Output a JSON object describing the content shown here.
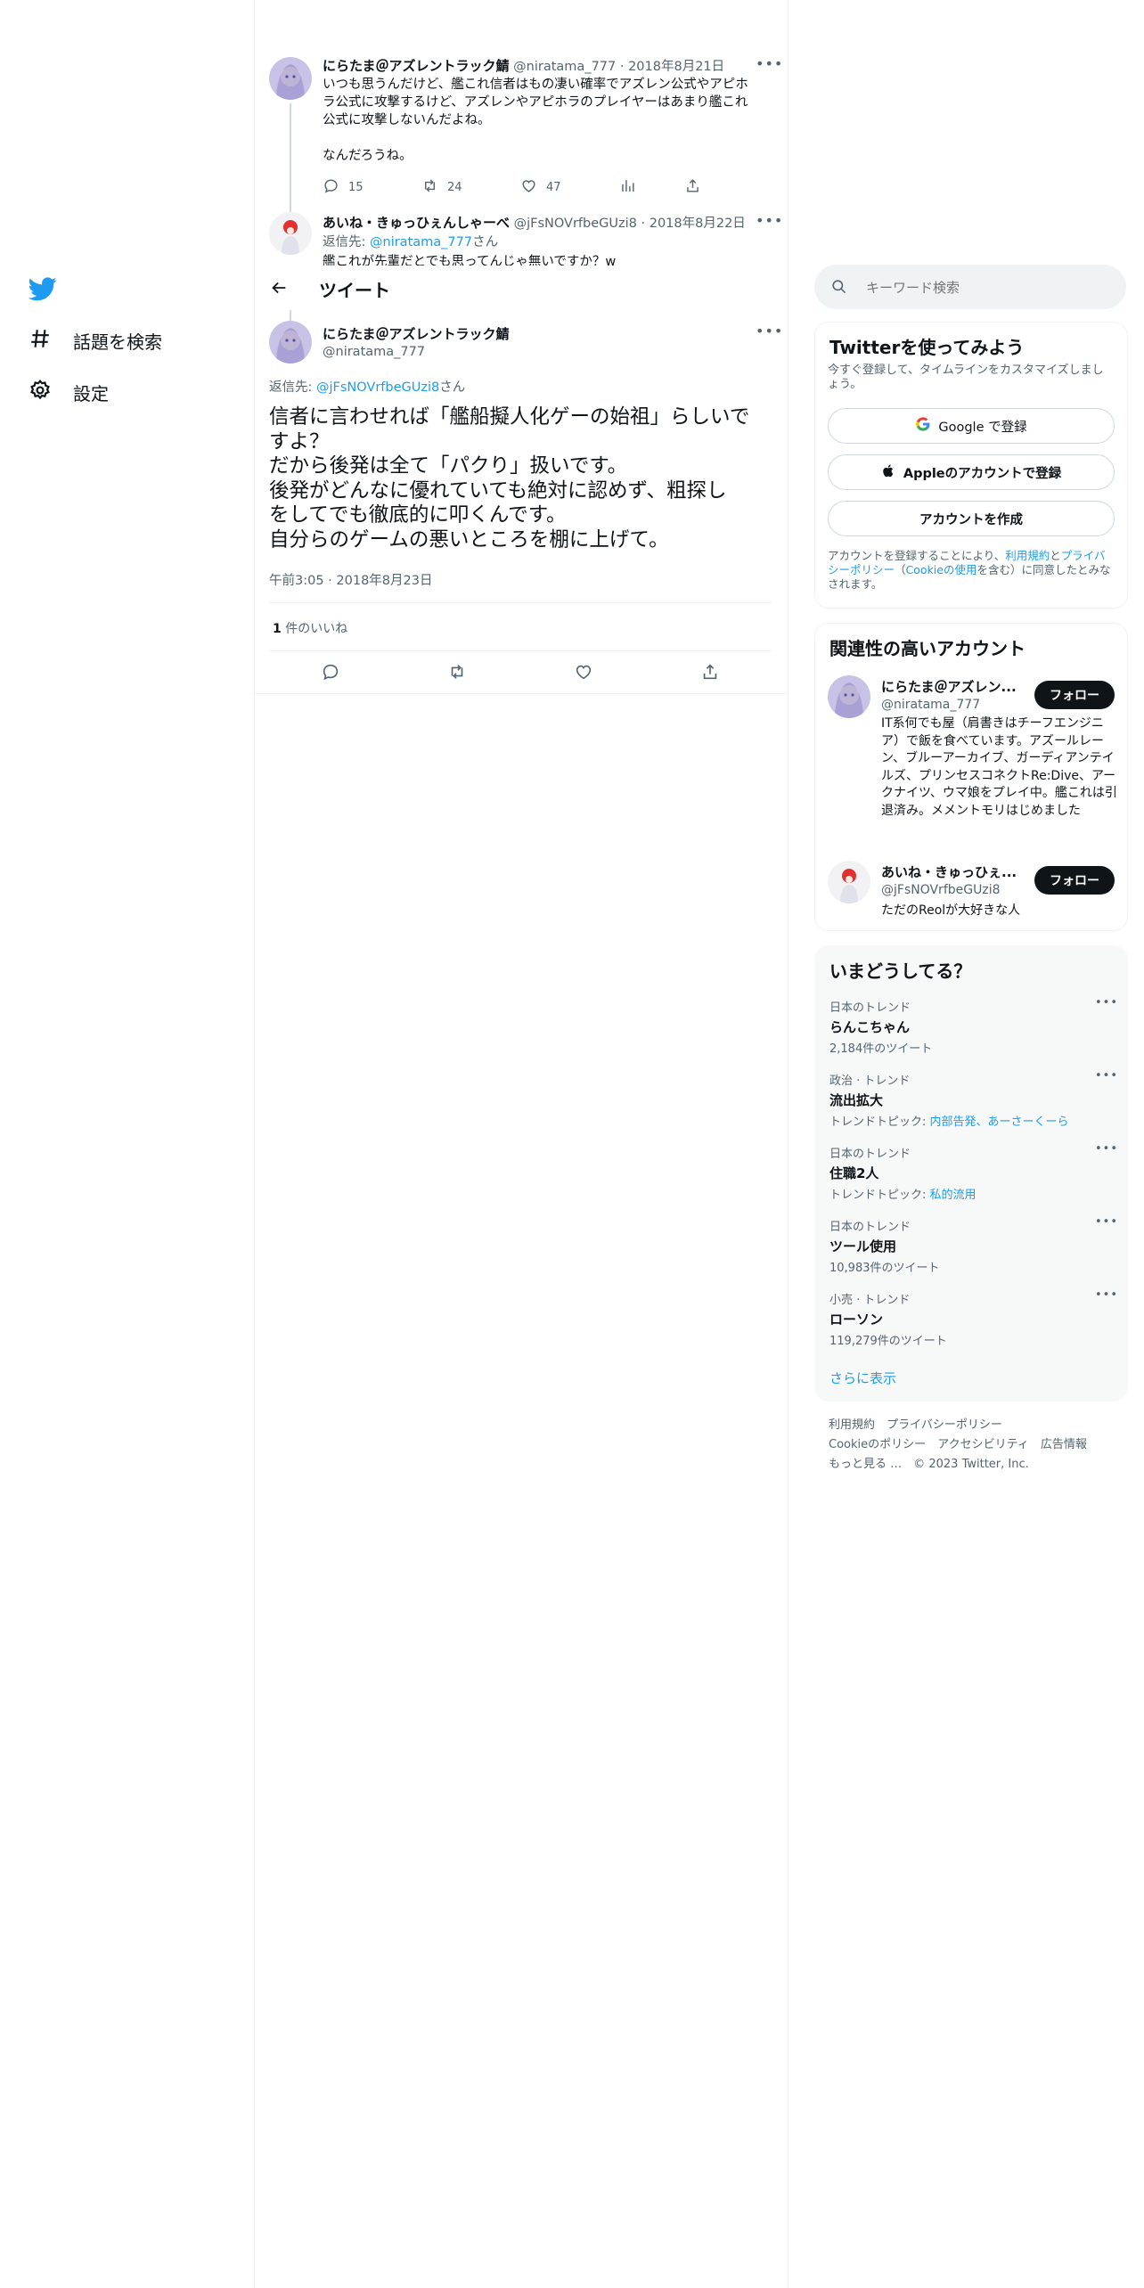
{
  "nav": {
    "items": [
      {
        "label": "話題を検索",
        "icon": "hashtag-icon"
      },
      {
        "label": "設定",
        "icon": "gear-icon"
      }
    ]
  },
  "header": {
    "title": "ツイート"
  },
  "context_tweets": [
    {
      "display_name": "にらたま＠アズレントラック鯖",
      "handle": "@niratama_777",
      "date": "2018年8月21日",
      "text_line1": "いつも思うんだけど、艦これ信者はもの凄い確率でアズレン公式やアピホ",
      "text_line2": "ラ公式に攻撃するけど、アズレンやアピホラのプレイヤーはあまり艦これ",
      "text_line3": "公式に攻撃しないんだよね。",
      "text_line4": "なんだろうね。",
      "replies": "15",
      "retweets": "24",
      "likes": "47"
    },
    {
      "display_name": "あいね・きゅっひぇんしゃーべ",
      "handle": "@jFsNOVrfbeGUzi8",
      "date": "2018年8月22日",
      "reply_prefix": "返信先: ",
      "reply_to": "@niratama_777",
      "reply_suffix": "さん",
      "text_partial": "艦これが先輩だとでも思ってんじゃ無いですか？w"
    }
  ],
  "main_tweet": {
    "display_name": "にらたま＠アズレントラック鯖",
    "handle": "@niratama_777",
    "reply_prefix": "返信先: ",
    "reply_to": "@jFsNOVrfbeGUzi8",
    "reply_suffix": "さん",
    "lines": [
      "信者に言わせれば「艦船擬人化ゲーの始祖」らしいで",
      "すよ？",
      "だから後発は全て「パクり」扱いです。",
      "後発がどんなに優れていても絶対に認めず、粗探し",
      "をしてでも徹底的に叩くんです。",
      "自分らのゲームの悪いところを棚に上げて。"
    ],
    "timestamp": "午前3:05 · 2018年8月23日",
    "likes_count": "1",
    "likes_label": " 件のいいね"
  },
  "search": {
    "placeholder": "キーワード検索"
  },
  "signup": {
    "title": "Twitterを使ってみよう",
    "subtitle": "今すぐ登録して、タイムラインをカスタマイズしましょう。",
    "google_label": "Google で登録",
    "apple_label": "Appleのアカウントで登録",
    "create_label": "アカウントを作成",
    "legal_1": "アカウントを登録することにより、",
    "legal_terms": "利用規約",
    "legal_2": "と",
    "legal_privacy": "プライバシーポリシー",
    "legal_3": "（",
    "legal_cookie": "Cookieの使用",
    "legal_4": "を含む）に同意したとみなされます。"
  },
  "related": {
    "title": "関連性の高いアカウント",
    "follow_label": "フォロー",
    "accounts": [
      {
        "display_name": "にらたま＠アズレン...",
        "handle": "@niratama_777",
        "bio": "IT系何でも屋（肩書きはチーフエンジニア）で飯を食べています。アズールレーン、ブルーアーカイブ、ガーディアンテイルズ、プリンセスコネクトRe:Dive、アークナイツ、ウマ娘をプレイ中。艦これは引退済み。メメントモリはじめました"
      },
      {
        "display_name": "あいね・きゅっひぇ...",
        "handle": "@jFsNOVrfbeGUzi8",
        "bio": "ただのReolが大好きな人"
      }
    ]
  },
  "trends": {
    "title": "いまどうしてる？",
    "items": [
      {
        "meta": "日本のトレンド",
        "name": "らんこちゃん",
        "sub": "2,184件のツイート",
        "topic_prefix": "",
        "topic_links": ""
      },
      {
        "meta": "政治 · トレンド",
        "name": "流出拡大",
        "sub": "",
        "topic_prefix": "トレンドトピック: ",
        "topic_links": "内部告発、あーさーくーら"
      },
      {
        "meta": "日本のトレンド",
        "name": "住職2人",
        "sub": "",
        "topic_prefix": "トレンドトピック: ",
        "topic_links": "私的流用"
      },
      {
        "meta": "日本のトレンド",
        "name": "ツール使用",
        "sub": "10,983件のツイート",
        "topic_prefix": "",
        "topic_links": ""
      },
      {
        "meta": "小売 · トレンド",
        "name": "ローソン",
        "sub": "119,279件のツイート",
        "topic_prefix": "",
        "topic_links": ""
      }
    ],
    "show_more": "さらに表示"
  },
  "footer": {
    "terms": "利用規約",
    "privacy": "プライバシーポリシー",
    "cookie": "Cookieのポリシー",
    "accessibility": "アクセシビリティ",
    "ads": "広告情報",
    "more": "もっと見る …",
    "copyright": "© 2023 Twitter, Inc."
  },
  "colors": {
    "accent": "#1d9bf0",
    "text": "#0f1419",
    "muted": "#536471",
    "border": "#eff3f4"
  }
}
